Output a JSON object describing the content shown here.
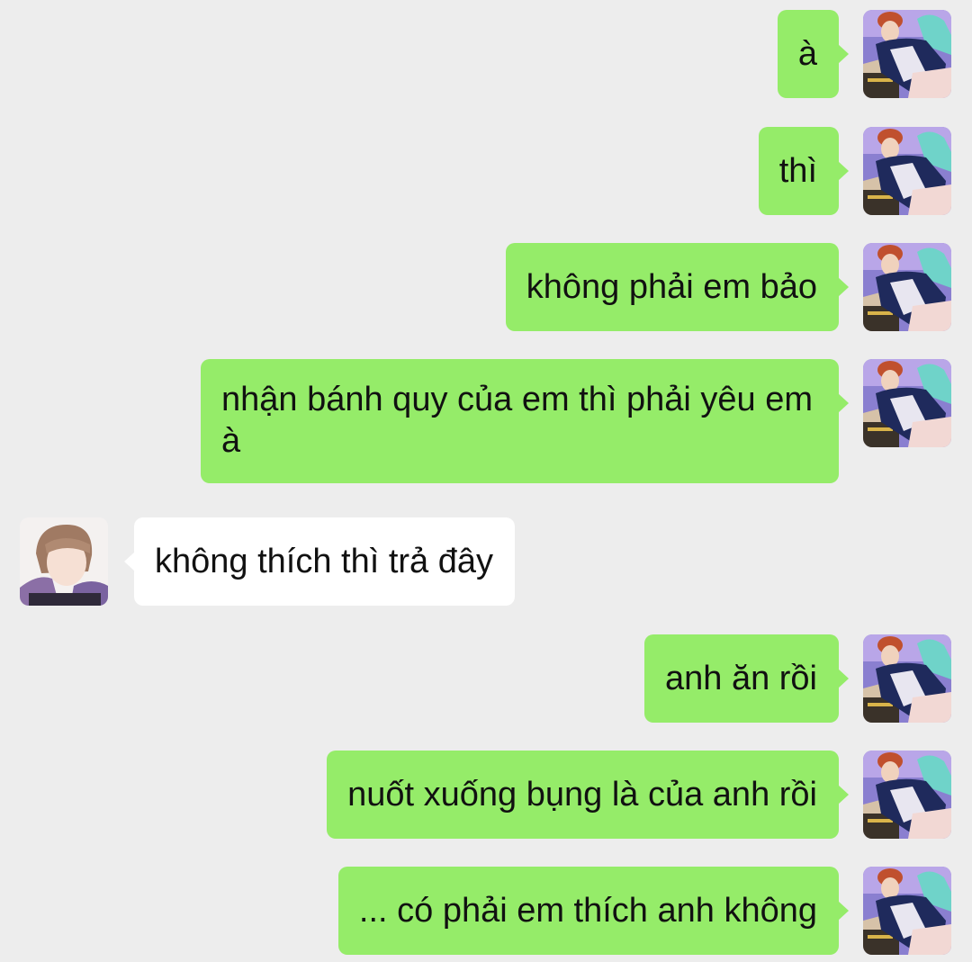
{
  "conversation": {
    "messages": [
      {
        "from": "me",
        "text": "à"
      },
      {
        "from": "me",
        "text": "thì"
      },
      {
        "from": "me",
        "text": "không phải em bảo"
      },
      {
        "from": "me",
        "text": "nhận bánh quy của em thì phải yêu em à"
      },
      {
        "from": "other",
        "text": "không thích thì trả đây"
      },
      {
        "from": "me",
        "text": "anh ăn rồi"
      },
      {
        "from": "me",
        "text": "nuốt xuống bụng là của anh rồi"
      },
      {
        "from": "me",
        "text": "... có phải em thích anh không"
      }
    ]
  },
  "colors": {
    "background": "#ededed",
    "sent_bubble": "#95ec69",
    "received_bubble": "#ffffff",
    "text": "#111111"
  }
}
